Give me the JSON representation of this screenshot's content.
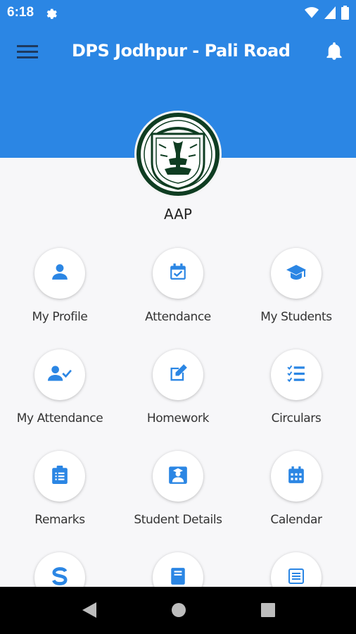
{
  "status": {
    "time": "6:18"
  },
  "app": {
    "title": "DPS Jodhpur - Pali Road",
    "org": "AAP"
  },
  "colors": {
    "primary": "#2b86e4",
    "icon": "#2b86e4",
    "background": "#f7f7f9"
  },
  "menu": [
    {
      "label": "My Profile",
      "icon": "person-icon"
    },
    {
      "label": "Attendance",
      "icon": "calendar-check-icon"
    },
    {
      "label": "My Students",
      "icon": "graduation-cap-icon"
    },
    {
      "label": "My Attendance",
      "icon": "person-check-icon"
    },
    {
      "label": "Homework",
      "icon": "edit-note-icon"
    },
    {
      "label": "Circulars",
      "icon": "checklist-icon"
    },
    {
      "label": "Remarks",
      "icon": "clipboard-icon"
    },
    {
      "label": "Student Details",
      "icon": "student-icon"
    },
    {
      "label": "Calendar",
      "icon": "calendar-icon"
    },
    {
      "label": "",
      "icon": "dollar-icon"
    },
    {
      "label": "",
      "icon": "book-icon"
    },
    {
      "label": "",
      "icon": "list-document-icon"
    }
  ]
}
